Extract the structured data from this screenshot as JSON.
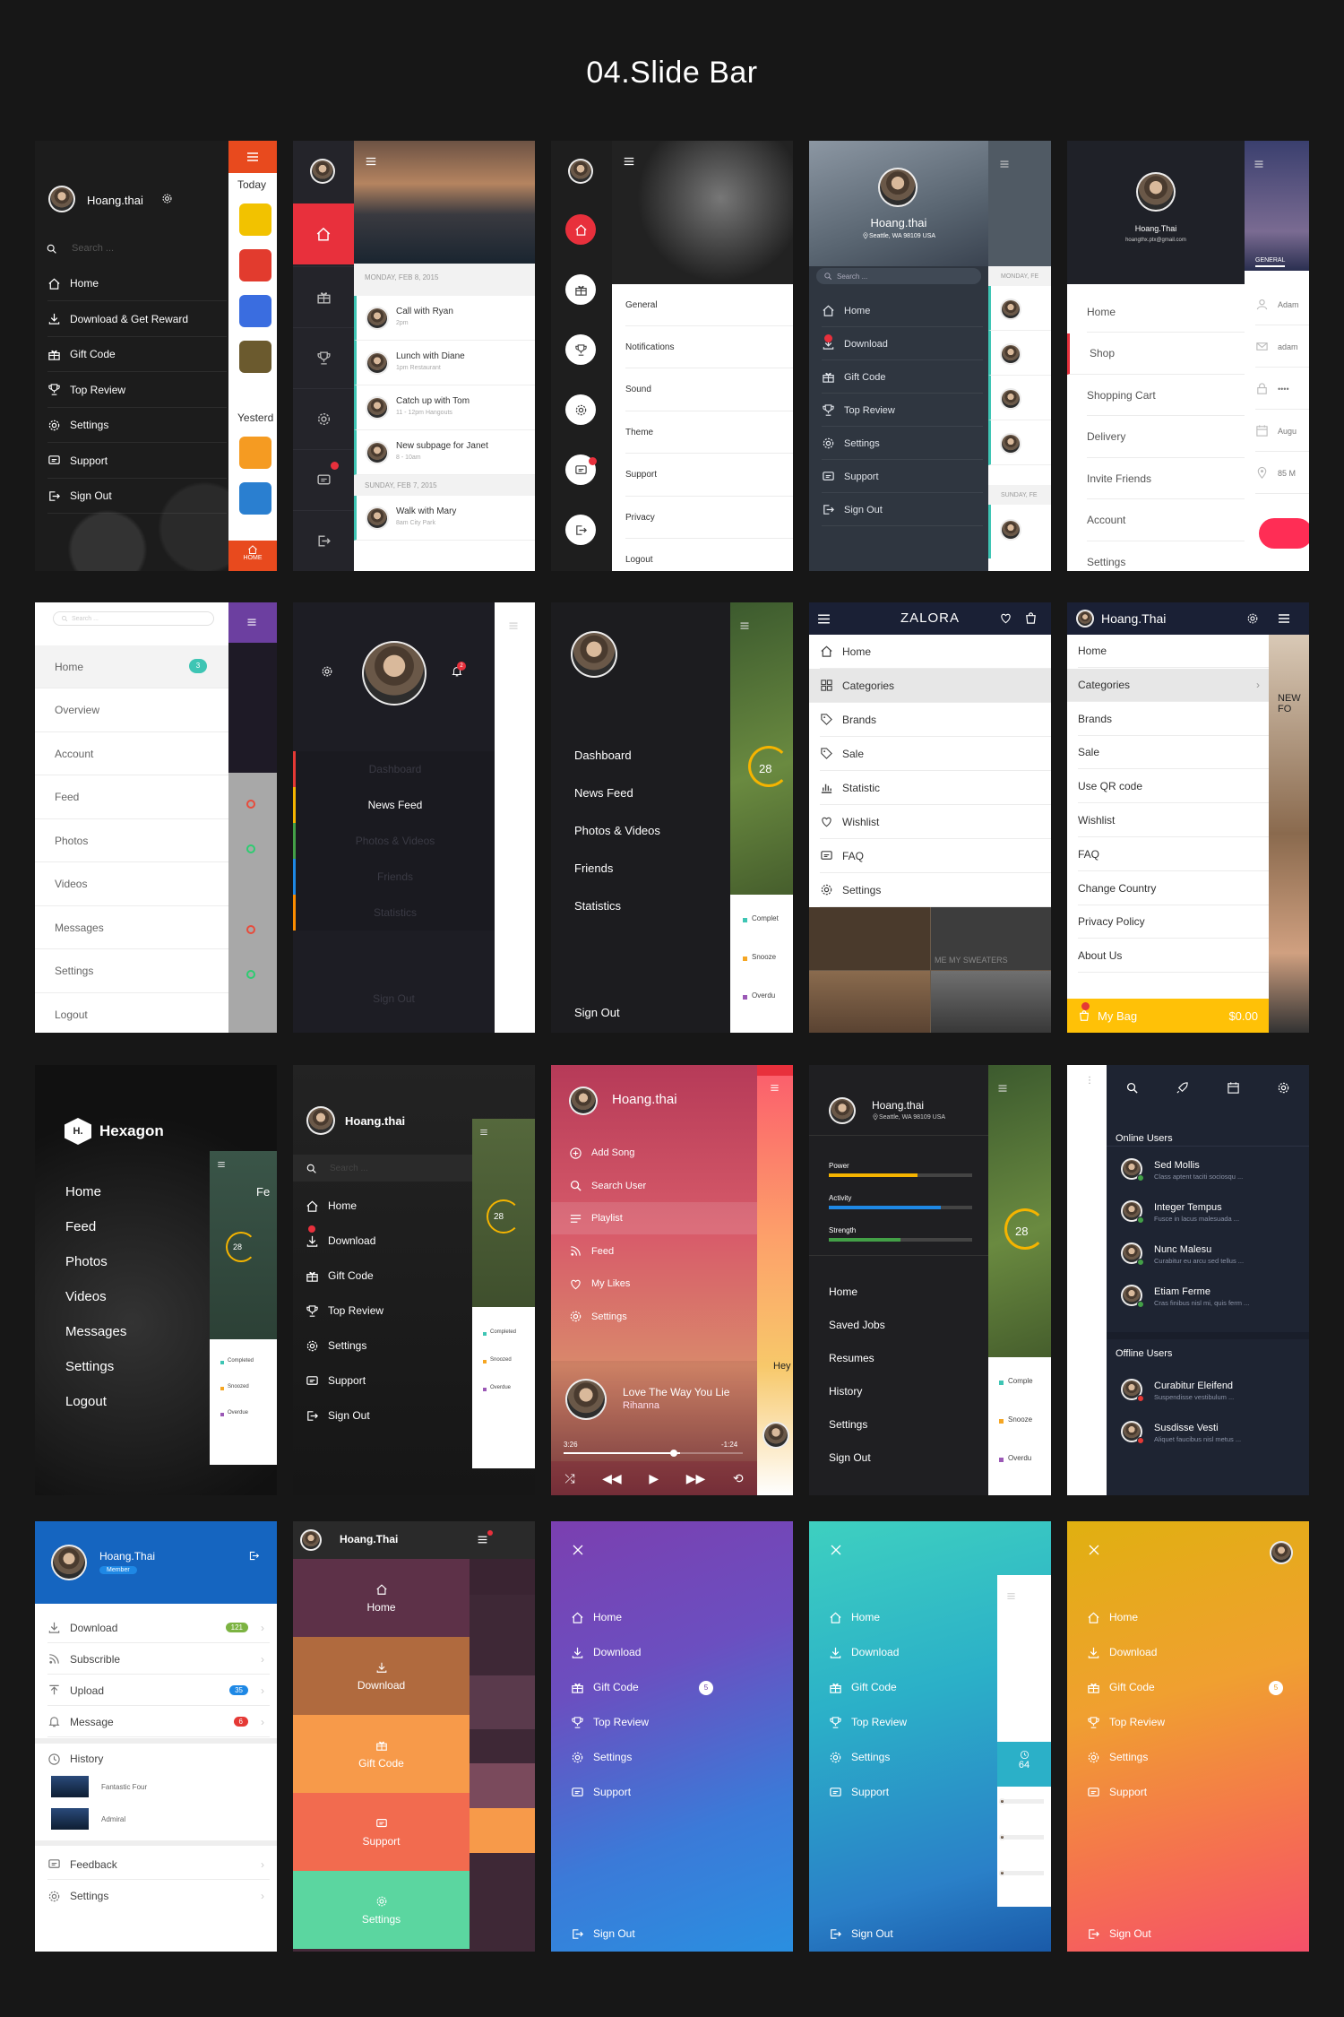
{
  "title": "04.Slide Bar",
  "colors": {
    "bg": "#171717",
    "red": "#e53935",
    "zalora_bar": "#1a2035",
    "yellow": "#ffc107"
  },
  "s1": {
    "user": "Hoang.thai",
    "search": "Search ...",
    "items": [
      "Home",
      "Download & Get Reward",
      "Gift Code",
      "Top Review",
      "Settings",
      "Support",
      "Sign Out"
    ],
    "icons": [
      "home-icon",
      "download-icon",
      "gift-icon",
      "trophy-icon",
      "gear-icon",
      "chat-icon",
      "signout-icon"
    ],
    "today": "Today",
    "yesterday": "Yesterd",
    "home": "HOME"
  },
  "s2": {
    "date1": "MONDAY, FEB 8, 2015",
    "date2": "SUNDAY, FEB 7, 2015",
    "events": [
      {
        "t": "Call with Ryan",
        "s": "2pm"
      },
      {
        "t": "Lunch with Diane",
        "s": "1pm     Restaurant"
      },
      {
        "t": "Catch up with Tom",
        "s": "11 - 12pm    Hangouts"
      },
      {
        "t": "New subpage for Janet",
        "s": "8 - 10am"
      },
      {
        "t": "Walk with Mary",
        "s": "8am     City Park"
      }
    ]
  },
  "s3": {
    "items": [
      "General",
      "Notifications",
      "Sound",
      "Theme",
      "Support",
      "Privacy",
      "Logout"
    ]
  },
  "s4": {
    "user": "Hoang.thai",
    "loc": "Seattle, WA 98109 USA",
    "search": "Search ...",
    "items": [
      "Home",
      "Download",
      "Gift Code",
      "Top Review",
      "Settings",
      "Support",
      "Sign Out"
    ],
    "date": "MONDAY, FE",
    "date2": "SUNDAY, FE"
  },
  "s5": {
    "user": "Hoang.Thai",
    "email": "hoangthx.ptx@gmail.com",
    "items": [
      "Home",
      "Shop",
      "Shopping Cart",
      "Delivery",
      "Invite Friends",
      "Account",
      "Settings"
    ],
    "tab": "GENERAL",
    "fields": [
      "Adam",
      "adam",
      "••••",
      "Augu",
      "85 M"
    ]
  },
  "s6": {
    "search": "Search ...",
    "items": [
      "Home",
      "Overview",
      "Account",
      "Feed",
      "Photos",
      "Videos",
      "Messages",
      "Settings",
      "Logout"
    ],
    "badge": "3"
  },
  "s7": {
    "items": [
      "Dashboard",
      "News Feed",
      "Photos & Videos",
      "Friends",
      "Statistics"
    ],
    "signout": "Sign Out",
    "badge": "2"
  },
  "s8": {
    "items": [
      "Dashboard",
      "News Feed",
      "Photos & Videos",
      "Friends",
      "Statistics"
    ],
    "signout": "Sign Out",
    "temp": "28",
    "legend": [
      "Complet",
      "Snooze",
      "Overdu"
    ]
  },
  "s9": {
    "brand": "ZALORA",
    "items": [
      "Home",
      "Categories",
      "Brands",
      "Sale",
      "Statistic",
      "Wishlist",
      "FAQ",
      "Settings"
    ],
    "promo": "ME   MY SWEATERS"
  },
  "s10": {
    "user": "Hoang.Thai",
    "items": [
      "Home",
      "Categories",
      "Brands",
      "Sale",
      "Use QR code",
      "Wishlist",
      "FAQ",
      "Change Country",
      "Privacy Policy",
      "About Us"
    ],
    "bag": "My Bag",
    "price": "$0.00",
    "side": "NEW FO"
  },
  "s11": {
    "brand": "Hexagon",
    "logo": "H.",
    "items": [
      "Home",
      "Feed",
      "Photos",
      "Videos",
      "Messages",
      "Settings",
      "Logout"
    ],
    "peek": "Fe",
    "temp": "28",
    "legend": [
      "Completed",
      "Snoozed",
      "Overdue"
    ]
  },
  "s12": {
    "user": "Hoang.thai",
    "search": "Search ...",
    "items": [
      "Home",
      "Download",
      "Gift Code",
      "Top Review",
      "Settings",
      "Support",
      "Sign Out"
    ],
    "temp": "28",
    "legend": [
      "Completed",
      "Snoozed",
      "Overdue"
    ]
  },
  "s13": {
    "user": "Hoang.thai",
    "items": [
      "Add Song",
      "Search User",
      "Playlist",
      "Feed",
      "My Likes",
      "Settings"
    ],
    "song": "Love The Way You Lie",
    "artist": "Rihanna",
    "t0": "3:26",
    "t1": "-1:24",
    "peek": "Hey"
  },
  "s14": {
    "user": "Hoang.thai",
    "loc": "Seattle, WA 98109 USA",
    "bars": [
      {
        "l": "Power",
        "c": "#f5b400",
        "p": 0.62
      },
      {
        "l": "Activity",
        "c": "#1e88e5",
        "p": 0.78
      },
      {
        "l": "Strength",
        "c": "#43a047",
        "p": 0.5
      }
    ],
    "items": [
      "Home",
      "Saved Jobs",
      "Resumes",
      "History",
      "Settings",
      "Sign Out"
    ],
    "temp": "28",
    "legend": [
      "Comple",
      "Snooze",
      "Overdu"
    ]
  },
  "s15": {
    "online": "Online Users",
    "offline": "Offline Users",
    "users": [
      {
        "n": "Sed Mollis",
        "m": "Class aptent taciti sociosqu ...",
        "c": "#43a047"
      },
      {
        "n": "Integer Tempus",
        "m": "Fusce in lacus malesuada ...",
        "c": "#43a047"
      },
      {
        "n": "Nunc Malesu",
        "m": "Curabitur eu arcu sed tellus ...",
        "c": "#43a047"
      },
      {
        "n": "Etiam Ferme",
        "m": "Cras finibus nisl mi, quis ferm ...",
        "c": "#43a047"
      }
    ],
    "off": [
      {
        "n": "Curabitur Eleifend",
        "m": "Suspendisse vestibulum ...",
        "c": "#e53935"
      },
      {
        "n": "Susdisse Vesti",
        "m": "Aliquet faucibus nisl metus ...",
        "c": "#e53935"
      }
    ]
  },
  "s16": {
    "user": "Hoang.Thai",
    "role": "Member",
    "items": [
      {
        "l": "Download",
        "b": "121",
        "c": "#7cb342"
      },
      {
        "l": "Subscrible",
        "b": "",
        "c": ""
      },
      {
        "l": "Upload",
        "b": "35",
        "c": "#1e88e5"
      },
      {
        "l": "Message",
        "b": "6",
        "c": "#e53935"
      }
    ],
    "history": "History",
    "films": [
      "Fantastic Four",
      "Admiral"
    ],
    "feedback": "Feedback",
    "settings": "Settings"
  },
  "s17": {
    "user": "Hoang.Thai",
    "items": [
      "Home",
      "Download",
      "Gift Code",
      "Support",
      "Settings"
    ],
    "colors": [
      "#5d3148",
      "#b06a3e",
      "#f79a4a",
      "#f26b4f",
      "#5bd6a0"
    ]
  },
  "s18": {
    "items": [
      "Home",
      "Download",
      "Gift Code",
      "Top Review",
      "Settings",
      "Support"
    ],
    "signout": "Sign Out",
    "badge": "5"
  },
  "s19": {
    "items": [
      "Home",
      "Download",
      "Gift Code",
      "Top Review",
      "Settings",
      "Support"
    ],
    "signout": "Sign Out",
    "num": "64"
  },
  "s20": {
    "items": [
      "Home",
      "Download",
      "Gift Code",
      "Top Review",
      "Settings",
      "Support"
    ],
    "signout": "Sign Out",
    "badge": "5"
  }
}
